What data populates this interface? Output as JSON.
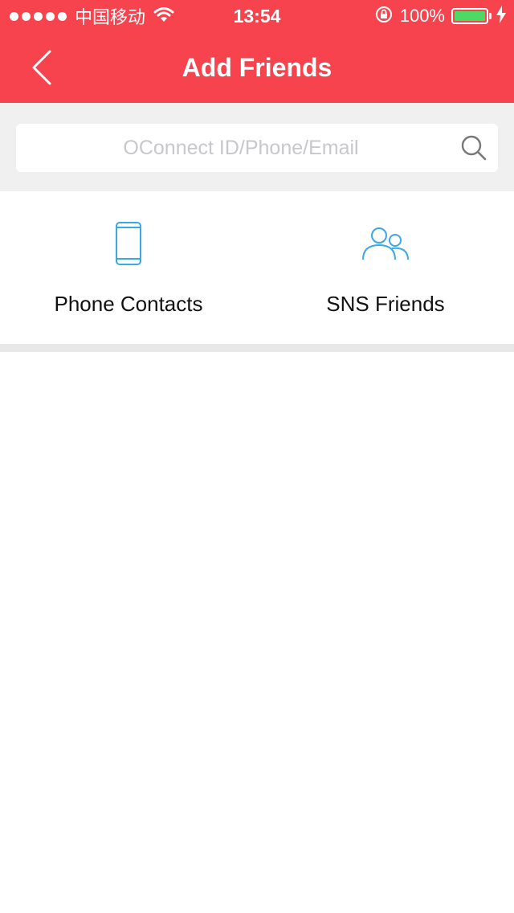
{
  "status_bar": {
    "carrier": "中国移动",
    "time": "13:54",
    "battery_percent": "100%",
    "battery_level": 1.0,
    "icons": [
      "signal-dots-icon",
      "wifi-icon",
      "orientation-lock-icon",
      "battery-icon",
      "charging-icon"
    ]
  },
  "nav": {
    "title": "Add Friends",
    "back_icon": "chevron-left-icon"
  },
  "search": {
    "placeholder": "OConnect ID/Phone/Email",
    "value": "",
    "icon": "search-icon"
  },
  "options": [
    {
      "label": "Phone Contacts",
      "icon": "phone-icon"
    },
    {
      "label": "SNS Friends",
      "icon": "people-icon"
    }
  ],
  "colors": {
    "header": "#f7434d",
    "accent_icon": "#3ba7e8",
    "background_gray": "#f0f0f0",
    "battery_green": "#4cd964"
  }
}
